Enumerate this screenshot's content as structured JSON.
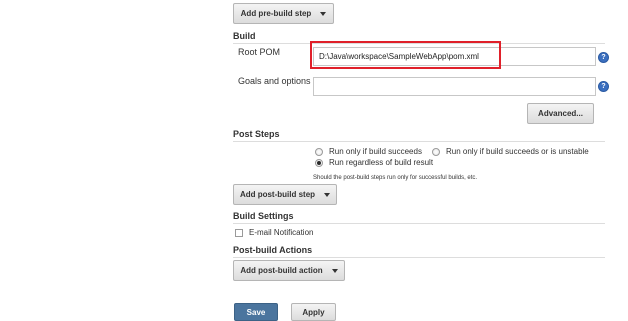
{
  "pre_build": {
    "add_step_label": "Add pre-build step"
  },
  "build": {
    "section_title": "Build",
    "root_pom_label": "Root POM",
    "root_pom_value": "D:\\Java\\workspace\\SampleWebApp\\pom.xml",
    "goals_label": "Goals and options",
    "goals_value": "",
    "advanced_label": "Advanced...",
    "help_glyph": "?"
  },
  "post_steps": {
    "section_title": "Post Steps",
    "options": [
      {
        "label": "Run only if build succeeds",
        "selected": false
      },
      {
        "label": "Run only if build succeeds or is unstable",
        "selected": false
      },
      {
        "label": "Run regardless of build result",
        "selected": true
      }
    ],
    "hint": "Should the post-build steps run only for successful builds, etc.",
    "add_step_label": "Add post-build step"
  },
  "build_settings": {
    "section_title": "Build Settings",
    "email_label": "E-mail Notification",
    "email_checked": false
  },
  "post_build_actions": {
    "section_title": "Post-build Actions",
    "add_action_label": "Add post-build action"
  },
  "footer": {
    "save_label": "Save",
    "apply_label": "Apply"
  },
  "colors": {
    "highlight_border": "#e0202a",
    "save_button": "#4b759e",
    "help_icon": "#3b6fbf"
  }
}
